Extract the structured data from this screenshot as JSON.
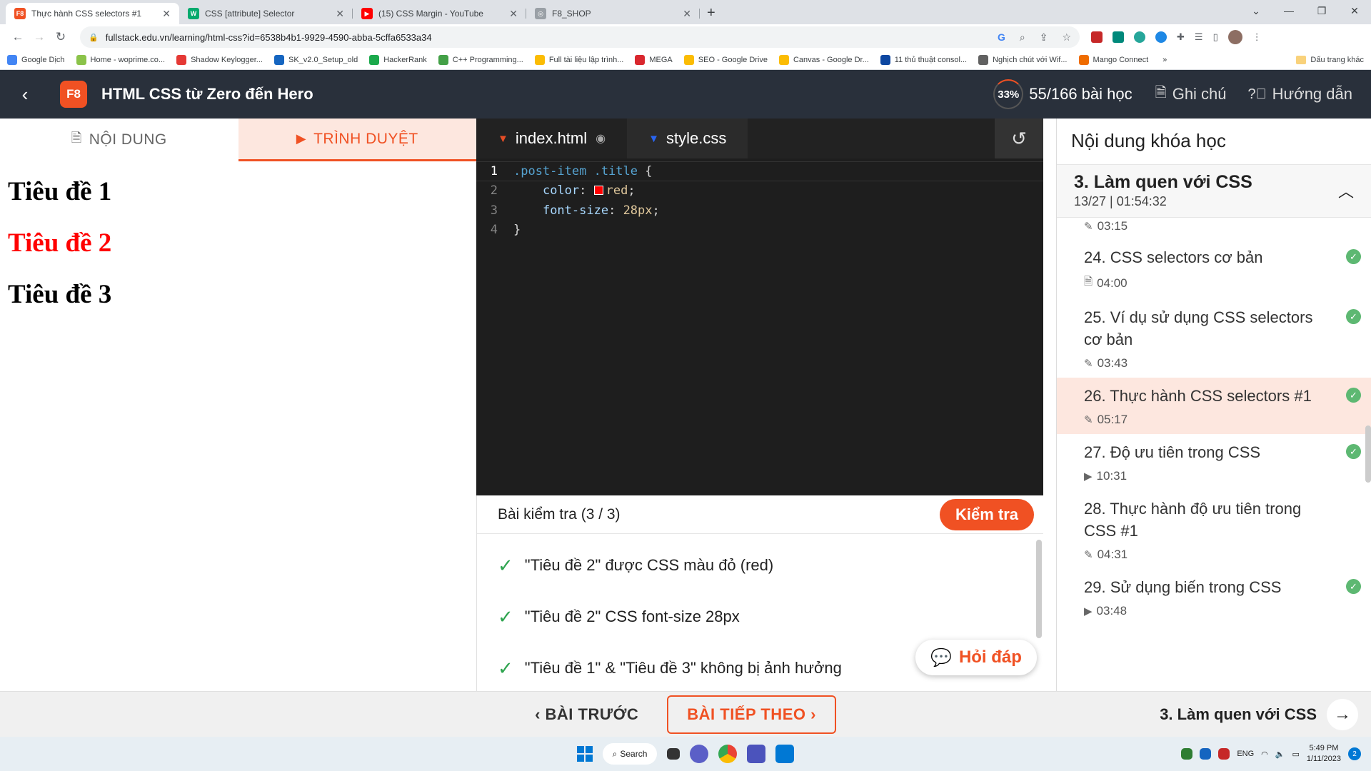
{
  "browser": {
    "tabs": [
      {
        "title": "Thực hành CSS selectors #1",
        "icon": "f8-favicon",
        "color": "#f05123",
        "letter": "F8"
      },
      {
        "title": "CSS [attribute] Selector",
        "icon": "w3schools-favicon",
        "color": "#04aa6d",
        "letter": "W"
      },
      {
        "title": "(15) CSS Margin - YouTube",
        "icon": "youtube-favicon",
        "color": "#ff0000",
        "letter": "▶"
      },
      {
        "title": "F8_SHOP",
        "icon": "globe-favicon",
        "color": "#9aa0a6",
        "letter": "◎"
      }
    ],
    "url": "fullstack.edu.vn/learning/html-css?id=6538b4b1-9929-4590-abba-5cffa6533a34",
    "bookmarks": [
      {
        "label": "Google Dịch",
        "color": "#4285f4"
      },
      {
        "label": "Home - woprime.co...",
        "color": "#8bc34a"
      },
      {
        "label": "Shadow Keylogger...",
        "color": "#e53935"
      },
      {
        "label": "SK_v2.0_Setup_old",
        "color": "#1565c0"
      },
      {
        "label": "HackerRank",
        "color": "#1ba94c"
      },
      {
        "label": "C++ Programming...",
        "color": "#43a047"
      },
      {
        "label": "Full tài liệu lập trình...",
        "color": "#fbbc04"
      },
      {
        "label": "MEGA",
        "color": "#d9272e"
      },
      {
        "label": "SEO - Google Drive",
        "color": "#fbbc04"
      },
      {
        "label": "Canvas - Google Dr...",
        "color": "#fbbc04"
      },
      {
        "label": "11 thủ thuật consol...",
        "color": "#0d47a1"
      },
      {
        "label": "Nghịch chút với Wif...",
        "color": "#616161"
      },
      {
        "label": "Mango Connect",
        "color": "#ef6c00"
      }
    ],
    "bookmarks_more": "»",
    "bookmarks_folder": "Dấu trang khác"
  },
  "header": {
    "logo": "F8",
    "title": "HTML CSS từ Zero đến Hero",
    "progress_percent": "33%",
    "progress_text": "55/166 bài học",
    "notes_label": "Ghi chú",
    "guide_label": "Hướng dẫn"
  },
  "preview": {
    "tab_content": "NỘI DUNG",
    "tab_browser": "TRÌNH DUYỆT",
    "headings": [
      "Tiêu đề 1",
      "Tiêu đề 2",
      "Tiêu đề 3"
    ]
  },
  "editor": {
    "tab_html": "index.html",
    "tab_css": "style.css",
    "lines": [
      {
        "n": "1",
        "selector": ".post-item .title",
        "brace": " {"
      },
      {
        "n": "2",
        "prop": "color",
        "value": "red"
      },
      {
        "n": "3",
        "prop": "font-size",
        "value": "28px"
      },
      {
        "n": "4",
        "brace": "}"
      }
    ]
  },
  "quiz": {
    "title": "Bài kiểm tra (3 / 3)",
    "check_button": "Kiểm tra",
    "items": [
      "\"Tiêu đề 2\" được CSS màu đỏ (red)",
      "\"Tiêu đề 2\" CSS font-size 28px",
      "\"Tiêu đề 1\" & \"Tiêu đề 3\" không bị ảnh hưởng"
    ],
    "help_button": "Hỏi đáp"
  },
  "sidebar": {
    "title": "Nội dung khóa học",
    "section_title": "3. Làm quen với CSS",
    "section_meta": "13/27 | 01:54:32",
    "lessons": [
      {
        "title": "",
        "duration": "03:15",
        "icon": "pencil",
        "done": false,
        "active": false,
        "partial": true
      },
      {
        "title": "24. CSS selectors cơ bản",
        "duration": "04:00",
        "icon": "document",
        "done": true,
        "active": false
      },
      {
        "title": "25. Ví dụ sử dụng CSS selectors cơ bản",
        "duration": "03:43",
        "icon": "pencil",
        "done": true,
        "active": false
      },
      {
        "title": "26. Thực hành CSS selectors #1",
        "duration": "05:17",
        "icon": "pencil",
        "done": true,
        "active": true
      },
      {
        "title": "27. Độ ưu tiên trong CSS",
        "duration": "10:31",
        "icon": "play",
        "done": true,
        "active": false
      },
      {
        "title": "28. Thực hành độ ưu tiên trong CSS #1",
        "duration": "04:31",
        "icon": "pencil",
        "done": false,
        "active": false
      },
      {
        "title": "29. Sử dụng biến trong CSS",
        "duration": "03:48",
        "icon": "play",
        "done": true,
        "active": false
      }
    ]
  },
  "footer": {
    "prev": "BÀI TRƯỚC",
    "next": "BÀI TIẾP THEO",
    "chapter": "3. Làm quen với CSS"
  },
  "taskbar": {
    "search": "Search",
    "lang": "ENG",
    "time": "5:49 PM",
    "date": "1/11/2023",
    "notifications": "2"
  }
}
